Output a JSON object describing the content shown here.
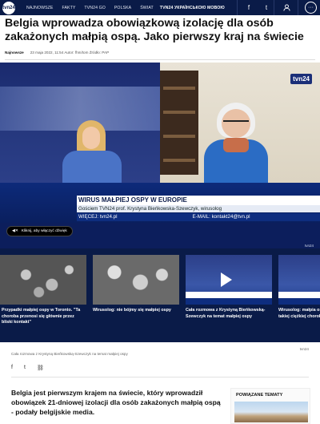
{
  "nav": {
    "logo_text": "tvn24",
    "items": [
      "NAJNOWSZE",
      "FAKTY",
      "TVN24 GO",
      "POLSKA",
      "ŚWIAT",
      "TVN24 УКРАЇНСЬКОЮ МОВОЮ"
    ],
    "icons": [
      "facebook-icon",
      "twitter-icon",
      "user-icon",
      "more-icon"
    ],
    "facebook_glyph": "f",
    "twitter_glyph": "t",
    "user_glyph": "👤",
    "more_glyph": "···"
  },
  "article": {
    "title": "Belgia wprowadza obowiązkową izolację dla osób zakażonych małpią ospą. Jako pierwszy kraj na świecie",
    "section": "Najnowsze",
    "meta": "23 maja 2022, 11:54 Autor: fhm/tom  Źródło: PAP",
    "lead": "Belgia jest pierwszym krajem na świecie, który wprowadził obowiązek 21-dniowej izolacji dla osób zakażonych małpią ospą - podały belgijskie media."
  },
  "video": {
    "bug": "tvn24",
    "band_title": "WIRUS MAŁPIEJ OSPY W EUROPIE",
    "band_sub": "Gościem TVN24 prof. Krystyna Bieńkowska-Szewczyk, wirusolog",
    "band_url_left": "WIĘCEJ: tvn24.pl",
    "band_url_right": "E-MAIL: kontakt24@tvn.pl",
    "sound_label": "Kliknij, aby włączyć dźwięk",
    "corner_mark": "tvn24"
  },
  "carousel": [
    {
      "title": "Przypadki małpiej ospy w Toronto. \"Ta choroba przenosi się głównie przez bliski kontakt\""
    },
    {
      "title": "Wirusolog: nie bójmy się małpiej ospy"
    },
    {
      "title": "Cała rozmowa z Krystyną Bieńkowską-Szewczyk na temat małpiej ospy"
    },
    {
      "title": "Wirusolog: małpia ospa nie wywołuje takiej ciężkiej choroby"
    }
  ],
  "caption": {
    "text": "Cała rozmowa z Krystyną Bieńkowską-Szewczyk na temat małpiej ospy",
    "source": "tvn24"
  },
  "shares": {
    "facebook": "f",
    "twitter": "t",
    "link": "⛓"
  },
  "related": {
    "heading": "POWIĄZANE TEMATY"
  }
}
